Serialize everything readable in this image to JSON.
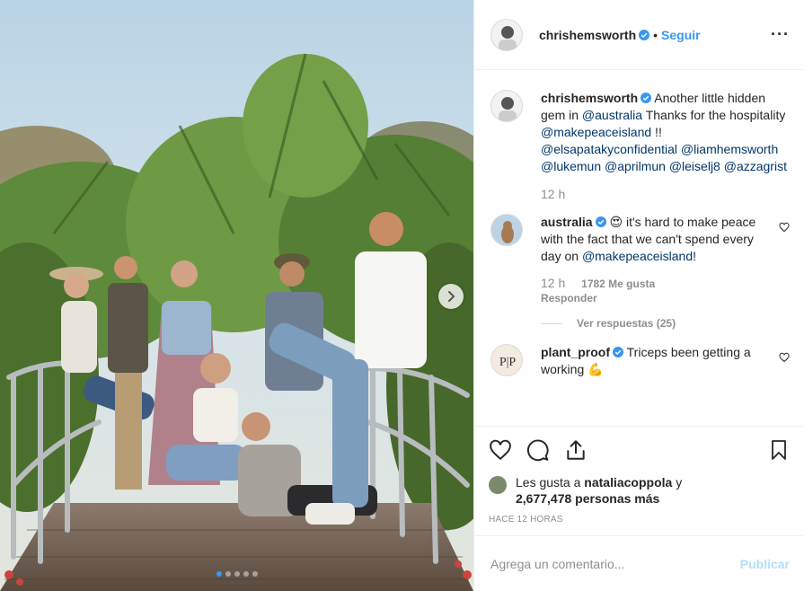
{
  "header": {
    "username": "chrishemsworth",
    "separator": "•",
    "follow_label": "Seguir",
    "more_label": "···",
    "icons": {
      "avatar": "avatar",
      "verified": "verified-badge-icon",
      "more": "more-options-icon"
    }
  },
  "caption": {
    "username": "chrishemsworth",
    "text_parts": [
      "Another little hidden gem in ",
      "@australia",
      " Thanks for the hospitality ",
      "@makepeaceisland",
      " !! ",
      "@elsapatakyconfidential",
      " ",
      "@liamhemsworth",
      " ",
      "@lukemun",
      " ",
      "@aprilmun",
      " ",
      "@leiselj8",
      " ",
      "@azzagrist"
    ],
    "time": "12 h"
  },
  "comments": [
    {
      "username": "australia",
      "emoji": "😍",
      "text_before": " it's hard to make peace with the fact that we can't spend every day on ",
      "mention": "@makepeaceisland",
      "text_after": "!",
      "time": "12 h",
      "likes": "1782 Me gusta",
      "reply_label": "Responder",
      "view_replies": "Ver respuestas (25)"
    },
    {
      "username": "plant_proof",
      "text": "Triceps been getting a working",
      "emoji": "💪"
    }
  ],
  "actions": {
    "icons": [
      "heart-icon",
      "comment-icon",
      "share-icon",
      "bookmark-icon"
    ],
    "likes_prefix": "Les gusta a ",
    "likes_user": "nataliacoppola",
    "likes_mid": " y",
    "likes_count": "2,677,478 personas más",
    "timestamp": "HACE 12 HORAS"
  },
  "add_comment": {
    "placeholder": "Agrega un comentario...",
    "publish_label": "Publicar"
  },
  "carousel": {
    "slides": 5,
    "current": 1
  },
  "colors": {
    "accent": "#3897f0",
    "mention": "#00376b",
    "muted": "#8e8e8e",
    "publish_disabled": "#b2dffc"
  }
}
